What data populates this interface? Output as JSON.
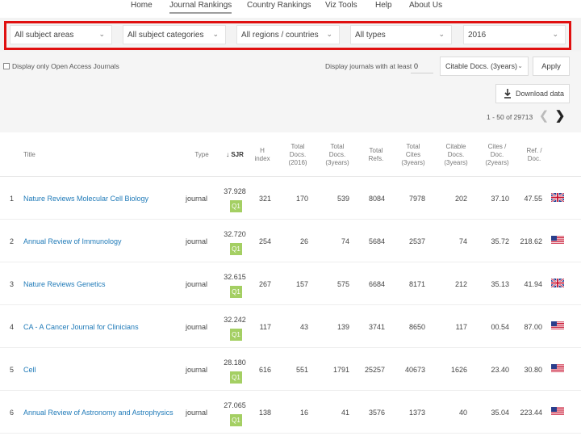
{
  "nav": {
    "items": [
      "Home",
      "Journal Rankings",
      "Country Rankings",
      "Viz Tools",
      "Help",
      "About Us"
    ],
    "active": "Journal Rankings"
  },
  "filters": {
    "subject_areas": "All subject areas",
    "subject_categories": "All subject categories",
    "regions": "All regions / countries",
    "types": "All types",
    "year": "2016"
  },
  "options": {
    "open_access_label": "Display only Open Access Journals",
    "min_label": "Display journals with at least",
    "min_value": "0",
    "citable_select": "Citable Docs. (3years)",
    "apply_label": "Apply",
    "download_label": "Download data",
    "pager_text": "1 - 50 of 29713"
  },
  "columns": {
    "title": "Title",
    "type": "Type",
    "sjr": "↓ SJR",
    "h_index": [
      "H",
      "index"
    ],
    "total_docs": [
      "Total",
      "Docs.",
      "(2016)"
    ],
    "total_docs_3y": [
      "Total",
      "Docs.",
      "(3years)"
    ],
    "total_refs": [
      "Total",
      "Refs."
    ],
    "total_cites": [
      "Total",
      "Cites",
      "(3years)"
    ],
    "citable_docs": [
      "Citable",
      "Docs.",
      "(3years)"
    ],
    "cites_doc": [
      "Cites /",
      "Doc.",
      "(2years)"
    ],
    "ref_doc": [
      "Ref. /",
      "Doc."
    ]
  },
  "rows": [
    {
      "rank": "1",
      "title": "Nature Reviews Molecular Cell Biology",
      "type": "journal",
      "sjr": "37.928",
      "quartile": "Q1",
      "h_index": "321",
      "total_docs": "170",
      "total_docs_3y": "539",
      "total_refs": "8084",
      "total_cites": "7978",
      "citable_docs": "202",
      "cites_doc": "37.10",
      "ref_doc": "47.55",
      "country": "uk"
    },
    {
      "rank": "2",
      "title": "Annual Review of Immunology",
      "type": "journal",
      "sjr": "32.720",
      "quartile": "Q1",
      "h_index": "254",
      "total_docs": "26",
      "total_docs_3y": "74",
      "total_refs": "5684",
      "total_cites": "2537",
      "citable_docs": "74",
      "cites_doc": "35.72",
      "ref_doc": "218.62",
      "country": "us"
    },
    {
      "rank": "3",
      "title": "Nature Reviews Genetics",
      "type": "journal",
      "sjr": "32.615",
      "quartile": "Q1",
      "h_index": "267",
      "total_docs": "157",
      "total_docs_3y": "575",
      "total_refs": "6684",
      "total_cites": "8171",
      "citable_docs": "212",
      "cites_doc": "35.13",
      "ref_doc": "41.94",
      "country": "uk"
    },
    {
      "rank": "4",
      "title": "CA - A Cancer Journal for Clinicians",
      "type": "journal",
      "sjr": "32.242",
      "quartile": "Q1",
      "h_index": "117",
      "total_docs": "43",
      "total_docs_3y": "139",
      "total_refs": "3741",
      "total_cites": "8650",
      "citable_docs": "117",
      "cites_doc": "00.54",
      "ref_doc": "87.00",
      "country": "us"
    },
    {
      "rank": "5",
      "title": "Cell",
      "type": "journal",
      "sjr": "28.180",
      "quartile": "Q1",
      "h_index": "616",
      "total_docs": "551",
      "total_docs_3y": "1791",
      "total_refs": "25257",
      "total_cites": "40673",
      "citable_docs": "1626",
      "cites_doc": "23.40",
      "ref_doc": "30.80",
      "country": "us"
    },
    {
      "rank": "6",
      "title": "Annual Review of Astronomy and Astrophysics",
      "type": "journal",
      "sjr": "27.065",
      "quartile": "Q1",
      "h_index": "138",
      "total_docs": "16",
      "total_docs_3y": "41",
      "total_refs": "3576",
      "total_cites": "1373",
      "citable_docs": "40",
      "cites_doc": "35.04",
      "ref_doc": "223.44",
      "country": "us"
    }
  ],
  "colors": {
    "highlight": "#e01010",
    "link": "#1f7ab8",
    "quartile_q1": "#a4cf63"
  }
}
